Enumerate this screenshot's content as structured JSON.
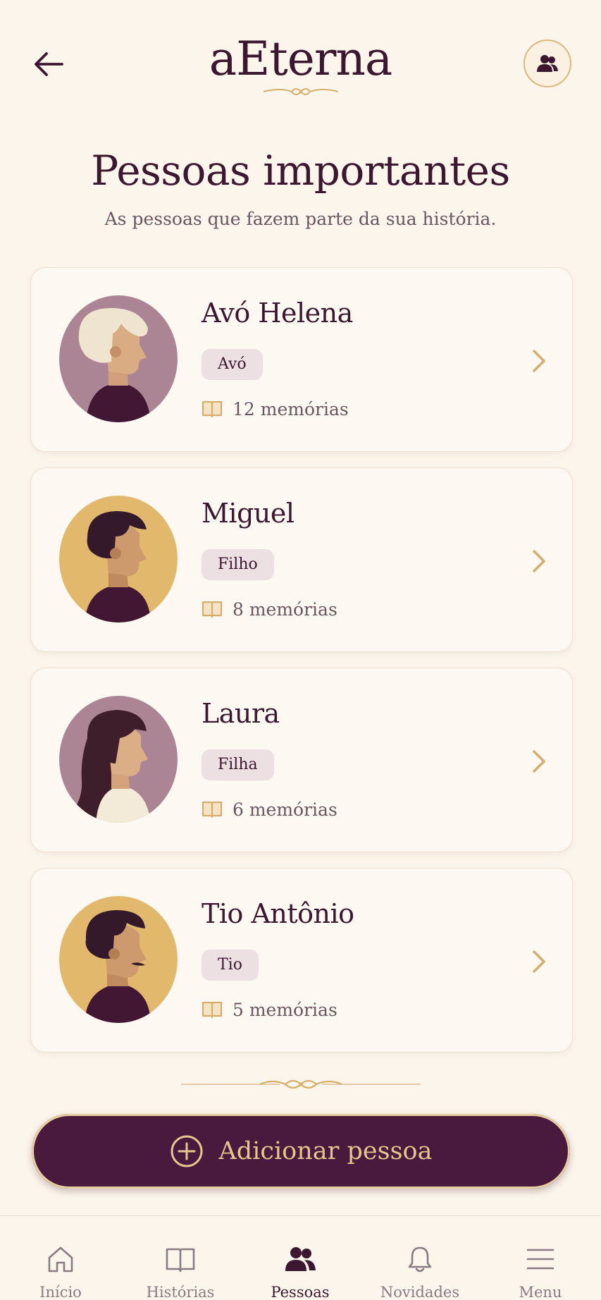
{
  "header": {
    "brand": "aEterna"
  },
  "page": {
    "title": "Pessoas importantes",
    "subtitle": "As pessoas que fazem parte da sua história."
  },
  "people": [
    {
      "name": "Avó Helena",
      "relation": "Avó",
      "memories": "12 memórias"
    },
    {
      "name": "Miguel",
      "relation": "Filho",
      "memories": "8 memórias"
    },
    {
      "name": "Laura",
      "relation": "Filha",
      "memories": "6 memórias"
    },
    {
      "name": "Tio Antônio",
      "relation": "Tio",
      "memories": "5 memórias"
    }
  ],
  "add_button": {
    "label": "Adicionar pessoa"
  },
  "tabbar": {
    "items": [
      {
        "label": "Início",
        "icon": "home-icon"
      },
      {
        "label": "Histórias",
        "icon": "book-icon"
      },
      {
        "label": "Pessoas",
        "icon": "people-icon",
        "active": true
      },
      {
        "label": "Novidades",
        "icon": "bell-icon"
      },
      {
        "label": "Menu",
        "icon": "menu-icon"
      }
    ]
  },
  "colors": {
    "background": "#fcf5ec",
    "primary": "#4a1a3e",
    "accent_gold": "#d4ae6a",
    "tag_bg": "#ece0e3"
  }
}
